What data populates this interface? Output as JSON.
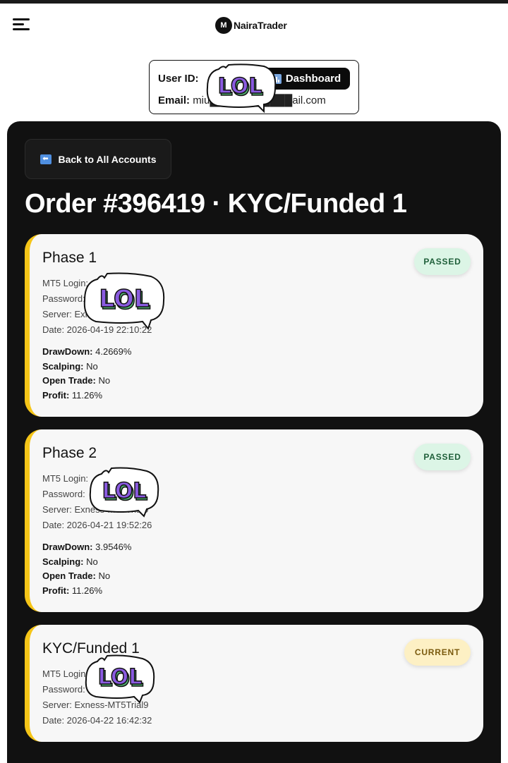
{
  "header": {
    "brand_name": "NairaTrader",
    "brand_logo_text": "M"
  },
  "user": {
    "user_id_label": "User ID:",
    "user_id_value": "",
    "email_label": "Email:",
    "email_value": "miu███████████ail.com",
    "dashboard_label": "Dashboard"
  },
  "main": {
    "back_label": "Back to All Accounts",
    "order_title": "Order #396419 · KYC/Funded 1"
  },
  "phases": [
    {
      "title": "Phase 1",
      "status": "PASSED",
      "login": "MT5 Login:",
      "password": "Password:",
      "server": "Server: Exness-MT5Trial9",
      "date": "Date: 2026-04-19 22:10:22",
      "drawdown_label": "DrawDown:",
      "drawdown": "4.2669%",
      "scalping_label": "Scalping:",
      "scalping": "No",
      "open_trade_label": "Open Trade:",
      "open_trade": "No",
      "profit_label": "Profit:",
      "profit": "11.26%"
    },
    {
      "title": "Phase 2",
      "status": "PASSED",
      "login": "MT5 Login:",
      "password": "Password:",
      "server": "Server: Exness-MT5Trial9",
      "date": "Date: 2026-04-21 19:52:26",
      "drawdown_label": "DrawDown:",
      "drawdown": "3.9546%",
      "scalping_label": "Scalping:",
      "scalping": "No",
      "open_trade_label": "Open Trade:",
      "open_trade": "No",
      "profit_label": "Profit:",
      "profit": "11.26%"
    },
    {
      "title": "KYC/Funded 1",
      "status": "CURRENT",
      "login": "MT5 Login:",
      "password": "Password:",
      "server": "Server: Exness-MT5Trial9",
      "date": "Date: 2026-04-22 16:42:32"
    }
  ],
  "stickers": {
    "text": "LOL"
  },
  "colors": {
    "accent": "#f5c518",
    "panel": "#111111",
    "passed_bg": "#dcf5e6",
    "current_bg": "#fdf0c4"
  }
}
